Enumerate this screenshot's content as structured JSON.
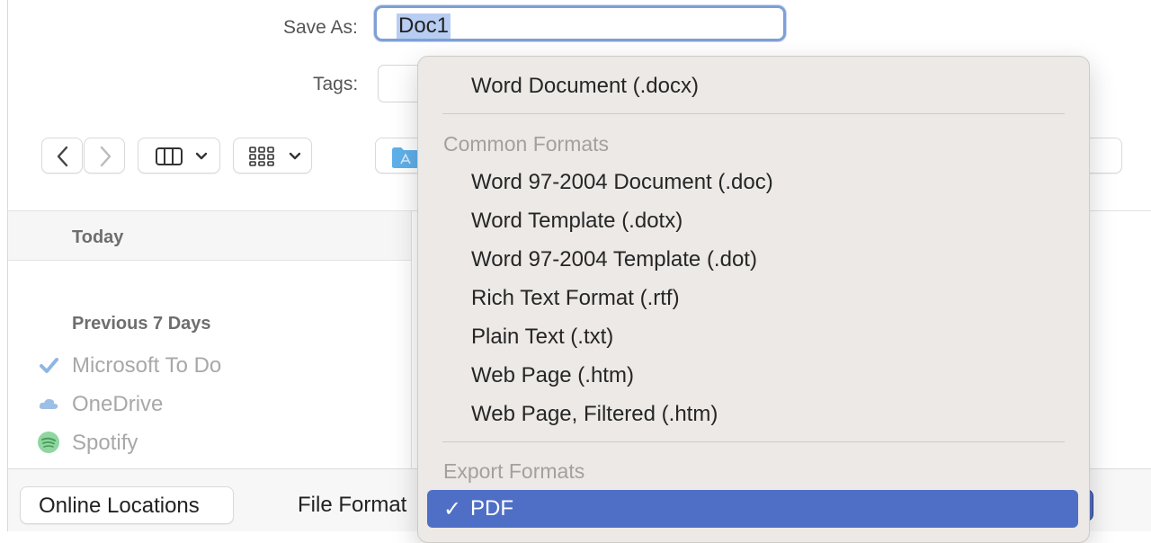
{
  "dialog": {
    "save_as_label": "Save As:",
    "save_as_value": "Doc1",
    "tags_label": "Tags:"
  },
  "sidebar": {
    "sections": [
      {
        "header": "Today",
        "items": []
      },
      {
        "header": "Previous 7 Days",
        "items": [
          {
            "label": "Microsoft To Do",
            "icon": "checkmark-icon"
          },
          {
            "label": "OneDrive",
            "icon": "cloud-icon"
          },
          {
            "label": "Spotify",
            "icon": "spotify-icon"
          }
        ]
      }
    ]
  },
  "bottom": {
    "online_locations": "Online Locations",
    "file_format_label": "File Format"
  },
  "format_menu": {
    "top_item": "Word Document (.docx)",
    "common_header": "Common Formats",
    "common_items": [
      "Word 97-2004 Document (.doc)",
      "Word Template (.dotx)",
      "Word 97-2004 Template (.dot)",
      "Rich Text Format (.rtf)",
      "Plain Text (.txt)",
      "Web Page (.htm)",
      "Web Page, Filtered (.htm)"
    ],
    "export_header": "Export Formats",
    "selected_item": "PDF",
    "selected_check": "✓"
  },
  "colors": {
    "selection": "#4f6fc6",
    "focus_ring": "#7f9fd6",
    "menu_bg": "#ece9e6"
  }
}
